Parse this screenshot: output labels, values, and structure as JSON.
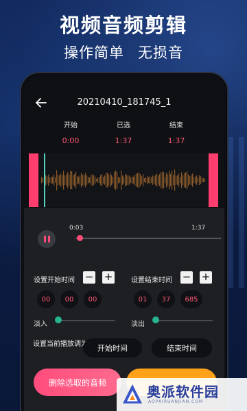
{
  "promo": {
    "title": "视频音频剪辑",
    "subtitle_left": "操作简单",
    "subtitle_right": "无损音"
  },
  "header": {
    "back_icon": "arrow-left-icon",
    "file_name": "20210410_181745_1"
  },
  "times": {
    "start_label": "开始",
    "start_value": "0:00",
    "selected_label": "已选",
    "selected_value": "1:37",
    "end_label": "结束",
    "end_value": "1:37"
  },
  "player": {
    "pause_icon": "pause-icon",
    "current_time": "0:03",
    "total_time": "1:37",
    "progress": 0.03
  },
  "start_time": {
    "label": "设置开始时间",
    "minus": "−",
    "plus": "+",
    "fields": [
      "00",
      "00",
      "00"
    ]
  },
  "end_time": {
    "label": "设置结束时间",
    "minus": "−",
    "plus": "+",
    "fields": [
      "01",
      "37",
      "685"
    ]
  },
  "fade": {
    "fade_in_label": "淡入",
    "fade_out_label": "淡出",
    "fade_in_level": 0,
    "fade_out_level": 0
  },
  "playback": {
    "label": "设置当前播放调为",
    "start_button": "开始时间",
    "end_button": "结束时间"
  },
  "actions": {
    "delete_selected": "删除选取的音频"
  },
  "watermark": {
    "brand": "奥派软件园",
    "url": "AOPAIRUANJIAN.COM"
  },
  "colors": {
    "accent_pink": "#ff4c7a",
    "accent_teal": "#27b38f",
    "accent_orange": "#ffa21a"
  }
}
